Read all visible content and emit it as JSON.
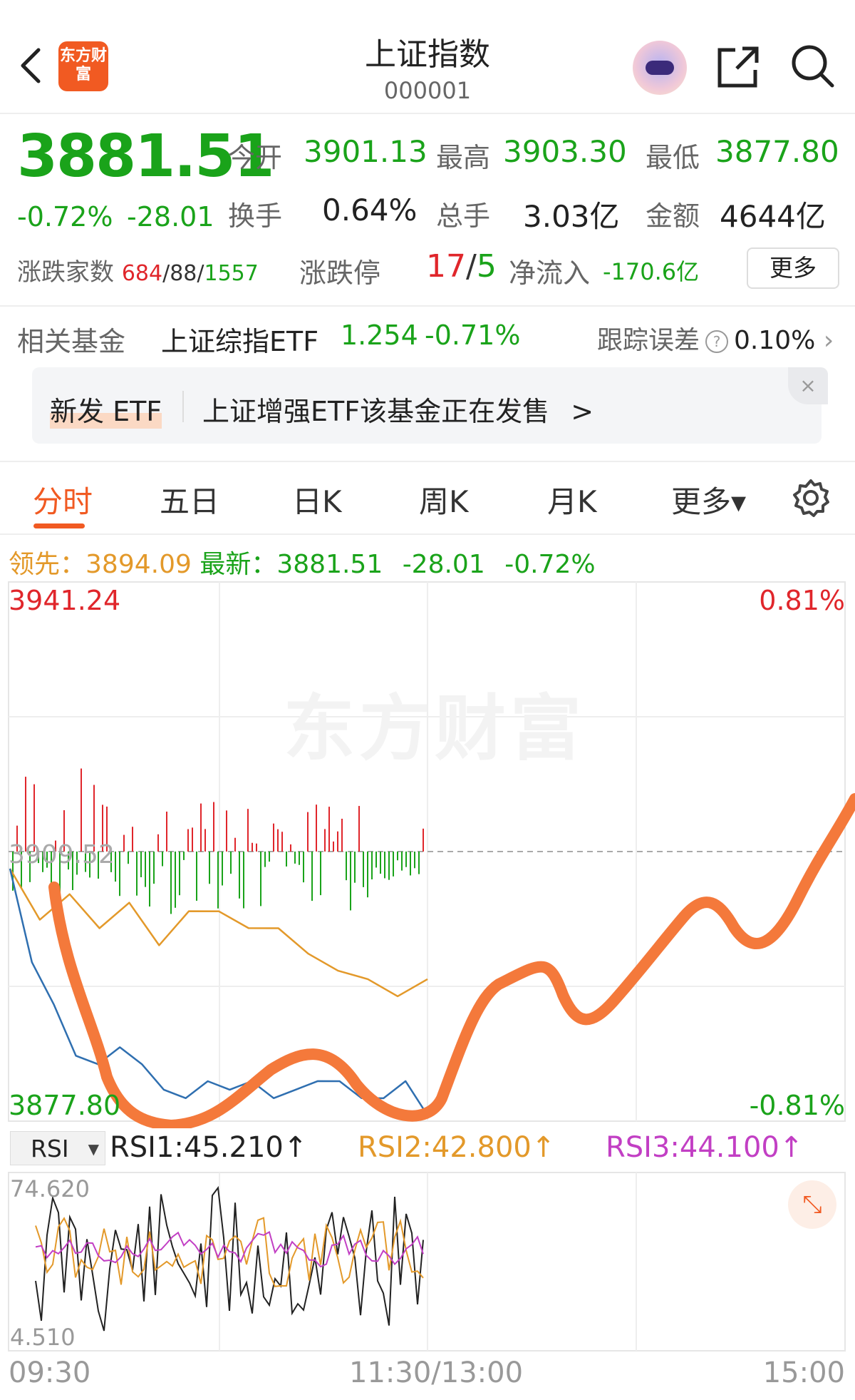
{
  "header": {
    "title": "上证指数",
    "code": "000001",
    "logo_text": "东方财富"
  },
  "quote": {
    "price": "3881.51",
    "change_pct": "-0.72%",
    "change": "-28.01",
    "open_label": "今开",
    "open": "3901.13",
    "high_label": "最高",
    "high": "3903.30",
    "low_label": "最低",
    "low": "3877.80",
    "turnover_label": "换手",
    "turnover": "0.64%",
    "volume_label": "总手",
    "volume": "3.03亿",
    "amount_label": "金额",
    "amount": "4644亿",
    "breadth_label": "涨跌家数",
    "up_count": "684",
    "sep1": "/",
    "flat_count": "88",
    "sep2": "/",
    "down_count": "1557",
    "limit_label": "涨跌停",
    "limit_up": "17",
    "limit_sep": "/",
    "limit_down": "5",
    "netflow_label": "净流入",
    "netflow": "-170.6亿",
    "more_label": "更多"
  },
  "fund": {
    "label": "相关基金",
    "name": "上证综指ETF",
    "price": "1.254",
    "change": "-0.71%",
    "tracking_label": "跟踪误差",
    "tracking_value": "0.10%",
    "banner_tag": "新发 ETF",
    "banner_text": "上证增强ETF该基金正在发售",
    "banner_arrow": ">"
  },
  "tabs": [
    {
      "label": "分时"
    },
    {
      "label": "五日"
    },
    {
      "label": "日K"
    },
    {
      "label": "周K"
    },
    {
      "label": "月K"
    },
    {
      "label": "更多▾"
    }
  ],
  "summary": {
    "lead_label": "领先：",
    "lead_value": "3894.09",
    "latest_label": "最新：",
    "latest_value": "3881.51",
    "latest_change": "-28.01",
    "latest_pct": "-0.72%"
  },
  "chart_labels": {
    "y_top": "3941.24",
    "y_bottom": "3877.80",
    "y_mid": "3909.52",
    "pct_top": "0.81%",
    "pct_bottom": "-0.81%",
    "watermark": "东方财富",
    "rsi_select": "RSI",
    "rsi1": "RSI1:45.210↑",
    "rsi2": "RSI2:42.800↑",
    "rsi3": "RSI3:44.100↑",
    "rsi_top": "74.620",
    "rsi_bottom": "4.510",
    "time_start": "09:30",
    "time_mid": "11:30/13:00",
    "time_end": "15:00"
  },
  "colors": {
    "up": "#e0262b",
    "down": "#1aa31a",
    "price_line": "#2f6fb0",
    "avg_line": "#e3992a",
    "brand": "#f15a22",
    "annotation": "#f4793b"
  },
  "chart_data": {
    "type": "line",
    "x_range": [
      "09:30",
      "15:00"
    ],
    "ylim": [
      3877.8,
      3941.24
    ],
    "prev_close": 3909.52,
    "series": [
      {
        "values": [
          3907,
          3897,
          3891,
          3886,
          3884,
          3887,
          3884,
          3882,
          3880,
          3883,
          3881,
          3883,
          3880,
          3882,
          3882,
          3883,
          3880,
          3881,
          3882,
          3879
        ]
      },
      {
        "values": [
          3907,
          3902,
          3904,
          3901,
          3903,
          3899,
          3902,
          3903,
          3900,
          3901,
          3897,
          3896,
          3894,
          3893,
          3894
        ]
      }
    ],
    "rsi": {
      "ylim": [
        4.51,
        74.62
      ],
      "rsi1": 45.21,
      "rsi2": 42.8,
      "rsi3": 44.1
    }
  }
}
